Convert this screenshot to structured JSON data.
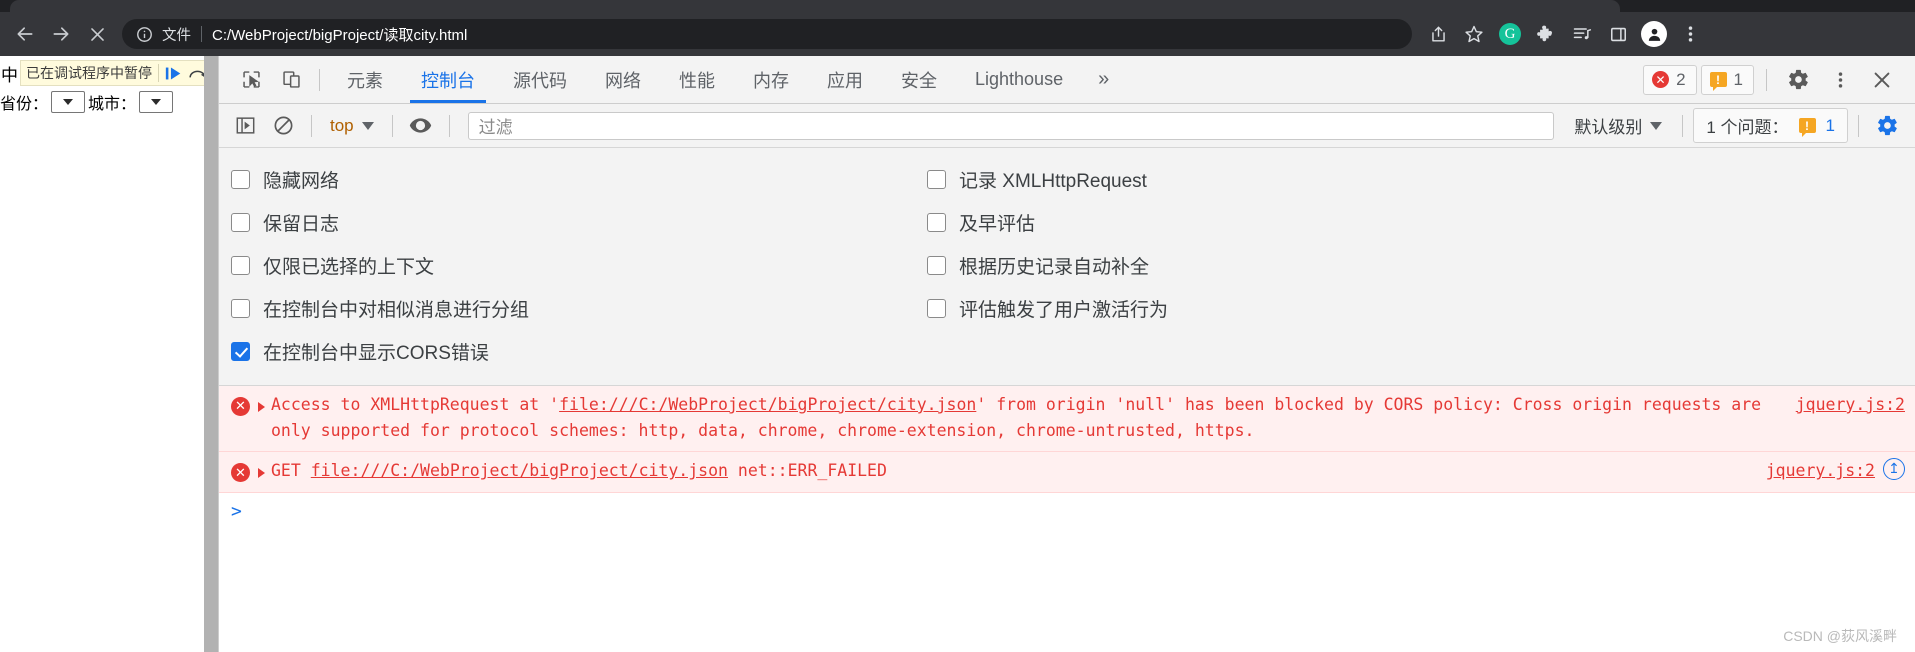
{
  "browser": {
    "nav": {
      "back_icon": "arrow-left-icon",
      "forward_icon": "arrow-right-icon",
      "stop_icon": "close-x-icon"
    },
    "omnibox": {
      "info_icon": "info-circle-icon",
      "file_label": "文件",
      "url": "C:/WebProject/bigProject/读取city.html"
    },
    "toolbar_right": [
      {
        "name": "share-icon",
        "glyph": "share"
      },
      {
        "name": "bookmark-star-icon",
        "glyph": "star"
      },
      {
        "name": "grammarly-extension-icon",
        "glyph": "G"
      },
      {
        "name": "extensions-puzzle-icon",
        "glyph": "puzzle"
      },
      {
        "name": "reading-list-icon",
        "glyph": "list-note"
      },
      {
        "name": "side-panel-icon",
        "glyph": "panel"
      },
      {
        "name": "profile-avatar-icon",
        "glyph": "person"
      },
      {
        "name": "chrome-menu-icon",
        "glyph": "kebab"
      }
    ]
  },
  "page": {
    "pause_prefix": "中",
    "pause_banner_text": "已在调试程序中暂停",
    "resume_icon": "resume-script-icon",
    "step_over_icon": "step-over-icon",
    "province_label": "省份：",
    "city_label": "城市："
  },
  "devtools": {
    "inspect_icon": "inspect-element-icon",
    "device_toolbar_icon": "device-toolbar-icon",
    "tabs": [
      {
        "label": "元素",
        "active": false
      },
      {
        "label": "控制台",
        "active": true
      },
      {
        "label": "源代码",
        "active": false
      },
      {
        "label": "网络",
        "active": false
      },
      {
        "label": "性能",
        "active": false
      },
      {
        "label": "内存",
        "active": false
      },
      {
        "label": "应用",
        "active": false
      },
      {
        "label": "安全",
        "active": false
      },
      {
        "label": "Lighthouse",
        "active": false
      }
    ],
    "more_tabs_glyph": "»",
    "error_badge": {
      "icon": "error-circle-icon",
      "count": "2"
    },
    "warning_badge": {
      "icon": "warning-icon",
      "count": "1"
    },
    "settings_icon": "gear-icon",
    "menu_icon": "kebab-menu-icon",
    "close_icon": "close-devtools-icon",
    "accent_color": "#1a73e8",
    "error_color": "#e53935",
    "warning_color": "#f5a623"
  },
  "console_toolbar": {
    "sidebar_icon": "console-sidebar-icon",
    "clear_icon": "clear-console-icon",
    "context_value": "top",
    "eye_icon": "live-expression-eye-icon",
    "filter_placeholder": "过滤",
    "filter_value": "",
    "level_label": "默认级别",
    "issues_label": "1 个问题：",
    "issues_count": "1",
    "console_settings_icon": "console-settings-gear-icon"
  },
  "settings": {
    "left_column": [
      {
        "label": "隐藏网络",
        "checked": false
      },
      {
        "label": "保留日志",
        "checked": false
      },
      {
        "label": "仅限已选择的上下文",
        "checked": false
      },
      {
        "label": "在控制台中对相似消息进行分组",
        "checked": false
      },
      {
        "label": "在控制台中显示CORS错误",
        "checked": true
      }
    ],
    "right_column": [
      {
        "label": "记录 XMLHttpRequest",
        "checked": false
      },
      {
        "label": "及早评估",
        "checked": false
      },
      {
        "label": "根据历史记录自动补全",
        "checked": false
      },
      {
        "label": "评估触发了用户激活行为",
        "checked": false
      }
    ]
  },
  "console_messages": [
    {
      "icon": "error-circle-icon",
      "expand_icon": "disclosure-triangle-icon",
      "text_before": "Access to XMLHttpRequest at '",
      "link": "file:///C:/WebProject/bigProject/city.json",
      "text_after": "' from origin 'null' has been blocked by CORS policy: Cross origin requests are only supported for protocol schemes: http, data, chrome, chrome-extension, chrome-untrusted, https.",
      "source": "jquery.js:2",
      "has_jump": false
    },
    {
      "icon": "error-circle-icon",
      "expand_icon": "disclosure-triangle-icon",
      "text_before": "GET ",
      "link": "file:///C:/WebProject/bigProject/city.json",
      "text_after": " net::ERR_FAILED",
      "source": "jquery.js:2",
      "has_jump": true,
      "jump_icon": "jump-to-source-icon"
    }
  ],
  "prompt": {
    "glyph": ">"
  },
  "watermark": "CSDN @荻风溪畔"
}
